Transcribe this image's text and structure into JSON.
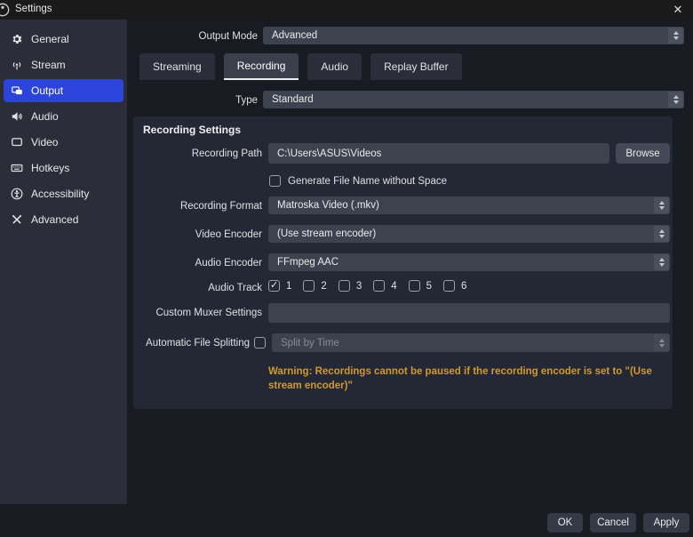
{
  "window": {
    "title": "Settings",
    "close_glyph": "✕"
  },
  "sidebar": {
    "selected": "Output",
    "items": [
      {
        "label": "General",
        "icon": "gear-icon"
      },
      {
        "label": "Stream",
        "icon": "antenna-icon"
      },
      {
        "label": "Output",
        "icon": "output-icon"
      },
      {
        "label": "Audio",
        "icon": "speaker-icon"
      },
      {
        "label": "Video",
        "icon": "monitor-icon"
      },
      {
        "label": "Hotkeys",
        "icon": "keyboard-icon"
      },
      {
        "label": "Accessibility",
        "icon": "accessibility-icon"
      },
      {
        "label": "Advanced",
        "icon": "tools-icon"
      }
    ]
  },
  "output_mode": {
    "label": "Output Mode",
    "value": "Advanced"
  },
  "tabs": {
    "active_tab": "Recording",
    "items": [
      {
        "label": "Streaming"
      },
      {
        "label": "Recording"
      },
      {
        "label": "Audio"
      },
      {
        "label": "Replay Buffer"
      }
    ]
  },
  "type_row": {
    "label": "Type",
    "value": "Standard"
  },
  "recording_settings": {
    "title": "Recording Settings",
    "recording_path": {
      "label": "Recording Path",
      "value": "C:\\Users\\ASUS\\Videos",
      "browse_label": "Browse"
    },
    "generate_no_space": {
      "label": "Generate File Name without Space",
      "checked": false
    },
    "recording_format": {
      "label": "Recording Format",
      "value": "Matroska Video (.mkv)"
    },
    "video_encoder": {
      "label": "Video Encoder",
      "value": "(Use stream encoder)"
    },
    "audio_encoder": {
      "label": "Audio Encoder",
      "value": "FFmpeg AAC"
    },
    "audio_track": {
      "label": "Audio Track",
      "tracks": [
        {
          "n": "1",
          "checked": true
        },
        {
          "n": "2",
          "checked": false
        },
        {
          "n": "3",
          "checked": false
        },
        {
          "n": "4",
          "checked": false
        },
        {
          "n": "5",
          "checked": false
        },
        {
          "n": "6",
          "checked": false
        }
      ]
    },
    "custom_muxer": {
      "label": "Custom Muxer Settings",
      "value": ""
    },
    "auto_split": {
      "label": "Automatic File Splitting",
      "checked": false,
      "value": "Split by Time",
      "disabled": true
    },
    "warning": "Warning: Recordings cannot be paused if the recording encoder is set to \"(Use stream encoder)\""
  },
  "footer": {
    "ok": "OK",
    "cancel": "Cancel",
    "apply": "Apply"
  },
  "colors": {
    "accent_blue": "#2c44d9",
    "warning_orange": "#d0992e",
    "sidebar_bg": "#2b2e38",
    "panel_bg": "#242834",
    "control_bg": "#3d434e",
    "window_bg": "#181b22",
    "titlebar_bg": "#1b1a1a"
  }
}
